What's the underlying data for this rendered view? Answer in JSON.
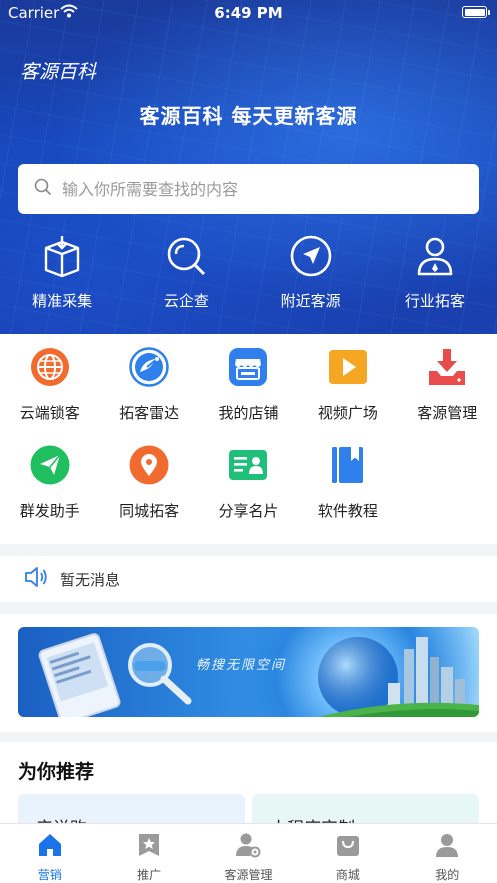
{
  "status_bar": {
    "carrier": "Carrier",
    "time": "6:49 PM"
  },
  "header": {
    "app_title": "客源百科",
    "slogan": "客源百科 每天更新客源"
  },
  "search": {
    "placeholder": "输入你所需要查找的内容"
  },
  "hero_actions": [
    {
      "label": "精准采集",
      "icon": "box-download-icon"
    },
    {
      "label": "云企查",
      "icon": "search-icon"
    },
    {
      "label": "附近客源",
      "icon": "navigation-icon"
    },
    {
      "label": "行业拓客",
      "icon": "user-icon"
    }
  ],
  "grid": [
    {
      "label": "云端锁客",
      "icon": "globe-icon",
      "color": "#f26b2e"
    },
    {
      "label": "拓客雷达",
      "icon": "radar-icon",
      "color": "#2f80ed"
    },
    {
      "label": "我的店铺",
      "icon": "store-icon",
      "color": "#2f80ed"
    },
    {
      "label": "视频广场",
      "icon": "play-icon",
      "color": "#f5a623"
    },
    {
      "label": "客源管理",
      "icon": "download-icon",
      "color": "#ea4c4c"
    },
    {
      "label": "群发助手",
      "icon": "send-icon",
      "color": "#1fbf5f"
    },
    {
      "label": "同城拓客",
      "icon": "location-icon",
      "color": "#f26b2e"
    },
    {
      "label": "分享名片",
      "icon": "card-icon",
      "color": "#1fbf7a"
    },
    {
      "label": "软件教程",
      "icon": "book-icon",
      "color": "#2f80ed"
    }
  ],
  "notice": {
    "text": "暂无消息"
  },
  "banner": {
    "text": "畅搜无限空间"
  },
  "recommend": {
    "title": "为你推荐",
    "cards": [
      {
        "label": "产说购"
      },
      {
        "label": "小程序定制"
      }
    ]
  },
  "tabs": [
    {
      "label": "营销",
      "icon": "home-icon",
      "active": true
    },
    {
      "label": "推广",
      "icon": "star-badge-icon",
      "active": false
    },
    {
      "label": "客源管理",
      "icon": "user-settings-icon",
      "active": false
    },
    {
      "label": "商城",
      "icon": "shop-bag-icon",
      "active": false
    },
    {
      "label": "我的",
      "icon": "profile-icon",
      "active": false
    }
  ],
  "colors": {
    "primary": "#1a73e8",
    "hero_bg": "#1746b8"
  }
}
